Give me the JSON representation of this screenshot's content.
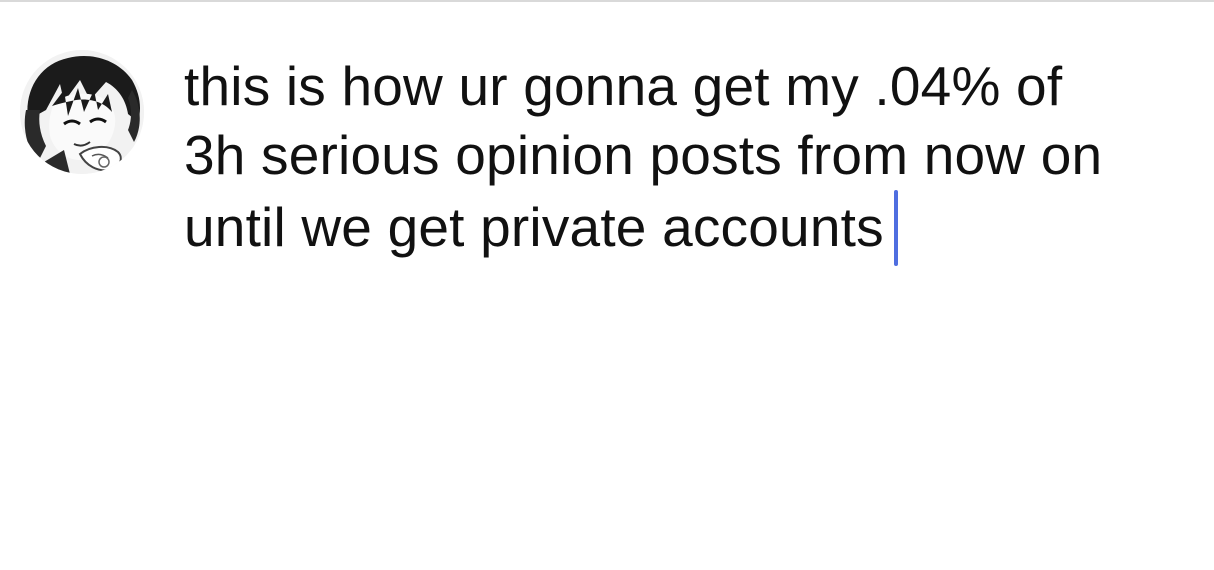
{
  "divider": true,
  "avatar": {
    "icon": "avatar-anime-character",
    "alt": ""
  },
  "compose": {
    "lines": [
      "this is how ur gonna get my .04% of",
      "3h serious opinion posts from now on",
      "until we get private accounts"
    ]
  },
  "colors": {
    "caret": "#4f6ee0",
    "text": "#111111",
    "divider": "#d9d9d9"
  }
}
